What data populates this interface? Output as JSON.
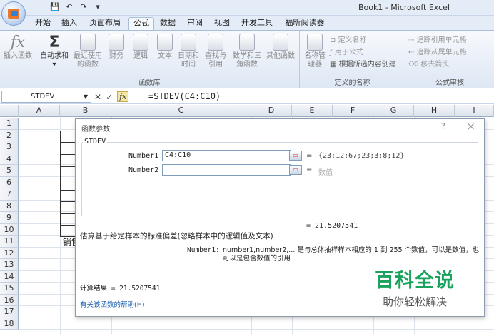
{
  "app": {
    "window_title": "Book1 - Microsoft Excel",
    "qat_icons": [
      "save-icon",
      "undo-icon",
      "redo-icon",
      "customize-icon"
    ]
  },
  "tabs": [
    "开始",
    "插入",
    "页面布局",
    "公式",
    "数据",
    "审阅",
    "视图",
    "开发工具",
    "福昕阅读器"
  ],
  "active_tab": "公式",
  "ribbon": {
    "insert_function": "插入函数",
    "autosum": "自动求和",
    "recent": "最近使用的函数",
    "financial": "财务",
    "logical": "逻辑",
    "text": "文本",
    "datetime": "日期和时间",
    "lookup": "查找与引用",
    "mathtrig": "数学和三角函数",
    "more": "其他函数",
    "library_label": "函数库",
    "name_manager": "名称管理器",
    "define_name": "定义名称",
    "use_in_formula": "用于公式",
    "create_from_sel": "根据所选内容创建",
    "names_label": "定义的名称",
    "trace_precedents": "追踪引用单元格",
    "trace_dependents": "追踪从属单元格",
    "remove_arrows": "移去箭头",
    "audit_label": "公式审核"
  },
  "formula_bar": {
    "name_box": "STDEV",
    "formula": "=STDEV(C4:C10)"
  },
  "columns": [
    "A",
    "B",
    "C",
    "D",
    "E",
    "F",
    "G",
    "H",
    "I"
  ],
  "rows": [
    "1",
    "2",
    "3",
    "4",
    "5",
    "6",
    "7",
    "8",
    "9",
    "10",
    "11",
    "12",
    "13",
    "14",
    "15",
    "16",
    "17",
    "18"
  ],
  "cell_b11": "销售",
  "dialog": {
    "title": "函数参数",
    "help": "?",
    "close": "×",
    "function_name": "STDEV",
    "arg1_label": "Number1",
    "arg1_value": "C4:C10",
    "arg1_result": "{23;12;67;23;3;8;12}",
    "arg2_label": "Number2",
    "arg2_value": "",
    "arg2_result": "数值",
    "equals": "=",
    "total_result": "= 21.5207541",
    "description": "估算基于给定样本的标准偏差(忽略样本中的逻辑值及文本)",
    "arg_help_label": "Number1:",
    "arg_help_text": "number1,number2,... 是与总体抽样样本相应的 1 到 255 个数值，可以是数值，也可以是包含数值的引用",
    "calc_result": "计算结果 = 21.5207541",
    "help_link": "有关该函数的帮助(H)"
  },
  "watermark": {
    "big": "百科全说",
    "small": "助你轻松解决"
  }
}
